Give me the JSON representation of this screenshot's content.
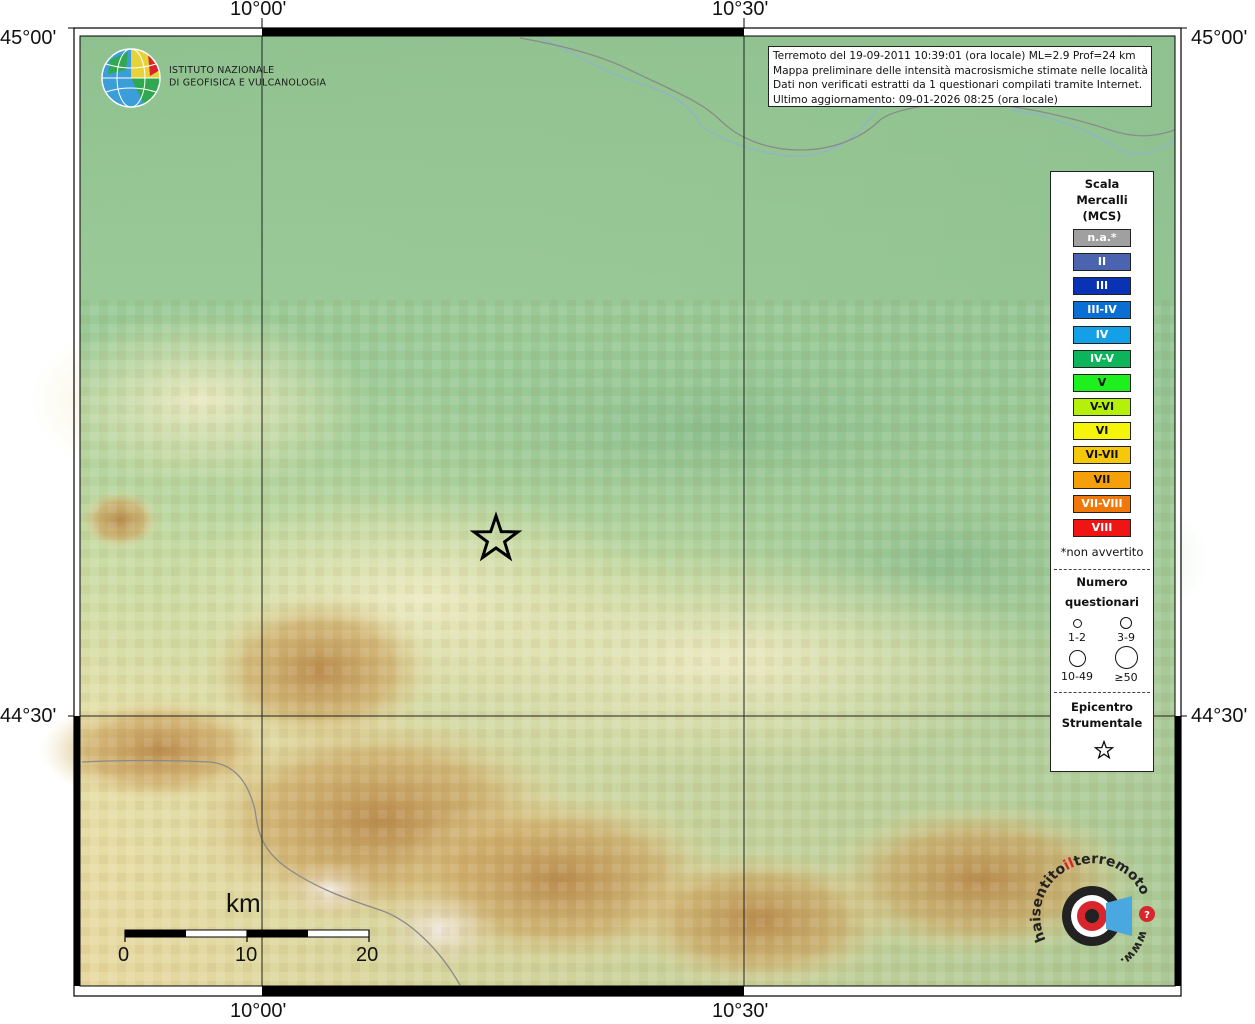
{
  "map": {
    "lon_ticks": [
      "10°00'",
      "10°30'"
    ],
    "lat_ticks": [
      "45°00'",
      "44°30'"
    ]
  },
  "institute": {
    "line1": "ISTITUTO NAZIONALE",
    "line2": "DI GEOFISICA E VULCANOLOGIA"
  },
  "info": {
    "line1": "Terremoto del 19-09-2011 10:39:01 (ora locale) ML=2.9 Prof=24 km",
    "line2": "Mappa preliminare delle intensità macrosismiche stimate nelle località",
    "line3": "Dati non verificati estratti da 1 questionari compilati tramite Internet.",
    "line4": "Ultimo aggiornamento: 09-01-2026 08:25 (ora locale)"
  },
  "legend": {
    "title_line1": "Scala",
    "title_line2": "Mercalli",
    "title_line3": "(MCS)",
    "classes": [
      {
        "label": "n.a.*",
        "color": "#a0a0a0"
      },
      {
        "label": "II",
        "color": "#4a64b0"
      },
      {
        "label": "III",
        "color": "#0a32b4"
      },
      {
        "label": "III-IV",
        "color": "#0a6ed2"
      },
      {
        "label": "IV",
        "color": "#14a0e6"
      },
      {
        "label": "IV-V",
        "color": "#0cb45a"
      },
      {
        "label": "V",
        "color": "#1ef01e"
      },
      {
        "label": "V-VI",
        "color": "#b4f00a"
      },
      {
        "label": "VI",
        "color": "#f5f50a"
      },
      {
        "label": "VI-VII",
        "color": "#f5c80a"
      },
      {
        "label": "VII",
        "color": "#f5a00a"
      },
      {
        "label": "VII-VIII",
        "color": "#f0780a"
      },
      {
        "label": "VIII",
        "color": "#f01414"
      }
    ],
    "na_note": "*non avvertito",
    "count_title_line1": "Numero",
    "count_title_line2": "questionari",
    "counts": [
      "1-2",
      "3-9",
      "10-49",
      "≥50"
    ],
    "epi_title_line1": "Epicentro",
    "epi_title_line2": "Strumentale"
  },
  "scalebar": {
    "unit": "km",
    "ticks": [
      "0",
      "10",
      "20"
    ]
  },
  "colors": {
    "lowland": "#9ec89a",
    "hills": "#e8e0a4",
    "mountains": "#c8a05a",
    "frame": "#000000"
  }
}
